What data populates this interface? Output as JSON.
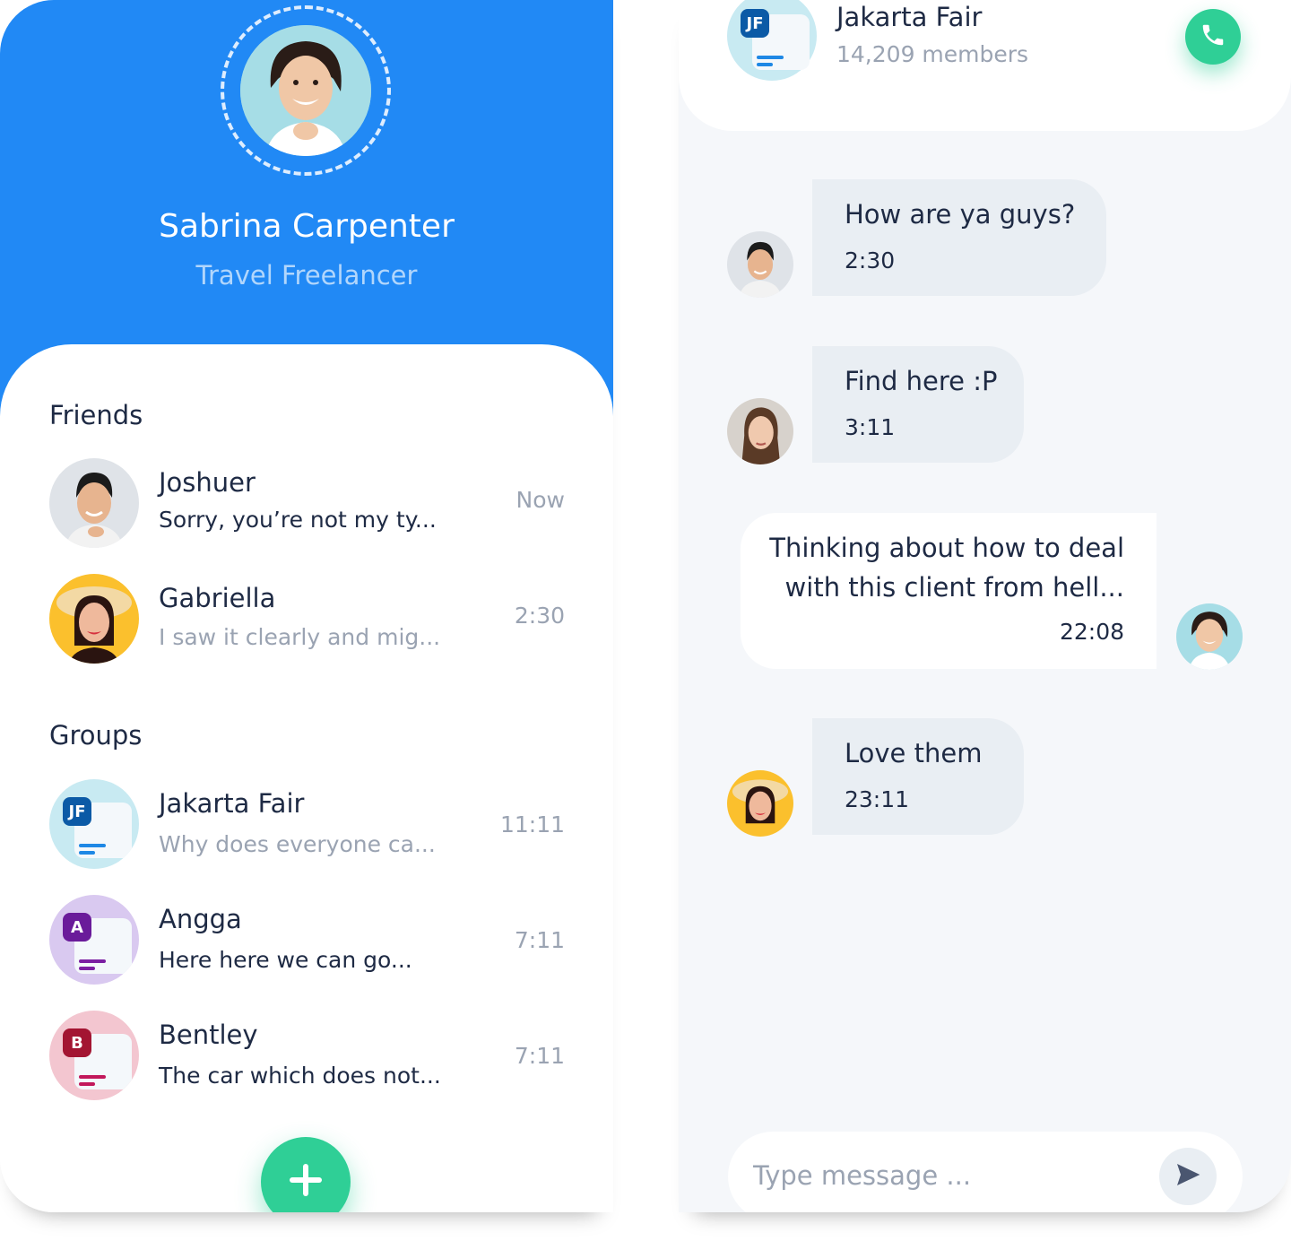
{
  "profile": {
    "name": "Sabrina Carpenter",
    "role": "Travel Freelancer"
  },
  "friends": {
    "title": "Friends",
    "items": [
      {
        "name": "Joshuer",
        "preview": "Sorry, you’re not my ty...",
        "time": "Now"
      },
      {
        "name": "Gabriella",
        "preview": "I saw it clearly and mig...",
        "time": "2:30"
      }
    ]
  },
  "groups": {
    "title": "Groups",
    "items": [
      {
        "name": "Jakarta Fair",
        "badge": "JF",
        "preview": "Why does everyone ca...",
        "time": "11:11"
      },
      {
        "name": "Angga",
        "badge": "A",
        "preview": "Here here we can go...",
        "time": "7:11"
      },
      {
        "name": "Bentley",
        "badge": "B",
        "preview": "The car which does not...",
        "time": "7:11"
      }
    ]
  },
  "chat": {
    "title": "Jakarta Fair",
    "badge": "JF",
    "members": "14,209 members",
    "messages": [
      {
        "text": "How are ya guys?",
        "time": "2:30"
      },
      {
        "text": "Find here :P",
        "time": "3:11"
      },
      {
        "line1": "Thinking about how to deal",
        "line2": "with this client from hell...",
        "time": "22:08"
      },
      {
        "text": "Love them",
        "time": "23:11"
      }
    ],
    "input_placeholder": "Type message ..."
  },
  "colors": {
    "primary_blue": "#2189f5",
    "accent_green": "#2fcf96",
    "text_dark": "#1e2a44",
    "text_muted": "#9aa3b2",
    "bubble_gray": "#e9eef3"
  },
  "icons": {
    "add": "plus-icon",
    "call": "phone-icon",
    "send": "send-icon"
  }
}
